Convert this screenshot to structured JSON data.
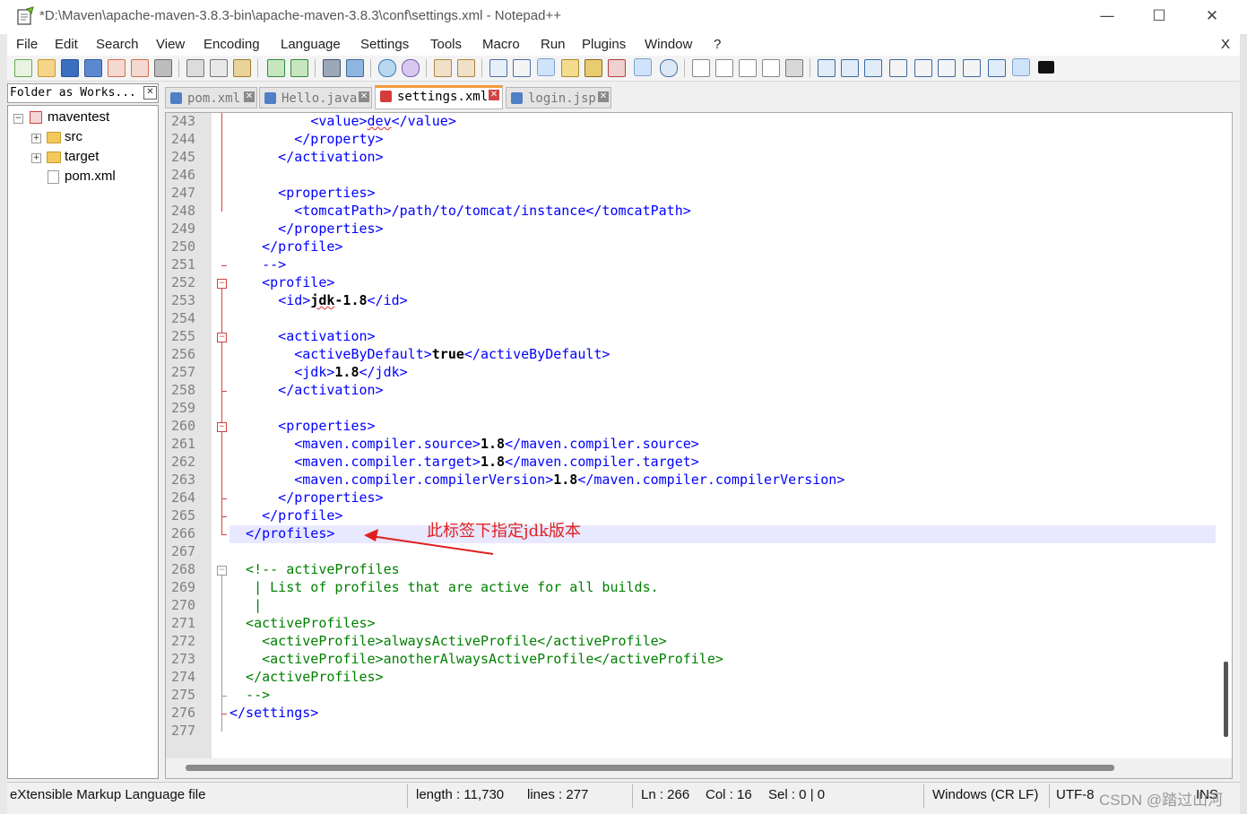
{
  "window": {
    "title": "*D:\\Maven\\apache-maven-3.8.3-bin\\apache-maven-3.8.3\\conf\\settings.xml - Notepad++",
    "minimize": "—",
    "maximize": "☐",
    "close": "✕"
  },
  "menu": {
    "items": [
      "File",
      "Edit",
      "Search",
      "View",
      "Encoding",
      "Language",
      "Settings",
      "Tools",
      "Macro",
      "Run",
      "Plugins",
      "Window",
      "?"
    ],
    "close_doc": "X"
  },
  "toolbar": {
    "icons": [
      "new-file-icon",
      "open-file-icon",
      "save-icon",
      "save-all-icon",
      "close-icon",
      "close-all-icon",
      "print-icon",
      "cut-icon",
      "copy-icon",
      "paste-icon",
      "undo-icon",
      "redo-icon",
      "find-icon",
      "replace-icon",
      "zoom-in-icon",
      "zoom-out-icon",
      "sync-vertical-icon",
      "sync-horizontal-icon",
      "word-wrap-icon",
      "show-all-chars-icon",
      "indent-guide-icon",
      "doc-map-icon",
      "function-list-icon",
      "folder-as-workspace-icon",
      "monitoring-icon",
      "record-macro-icon",
      "stop-record-icon",
      "play-macro-icon",
      "run-macro-multiple-icon",
      "save-macro-icon",
      "compare-icon",
      "plugin-a-icon",
      "plugin-b-icon",
      "first-icon",
      "prev-icon",
      "next-icon",
      "last-icon",
      "diff-icon",
      "spell-check-icon",
      "markdown-icon"
    ]
  },
  "folder_panel": {
    "title": "Folder as Works...",
    "close": "✕",
    "tree": [
      {
        "label": "maventest",
        "kind": "project",
        "expander": "−"
      },
      {
        "label": "src",
        "kind": "folder",
        "expander": "+"
      },
      {
        "label": "target",
        "kind": "folder",
        "expander": "+"
      },
      {
        "label": "pom.xml",
        "kind": "file",
        "expander": ""
      }
    ]
  },
  "tabs": [
    {
      "label": "pom.xml",
      "active": false
    },
    {
      "label": "Hello.java",
      "active": false
    },
    {
      "label": "settings.xml",
      "active": true
    },
    {
      "label": "login.jsp",
      "active": false
    }
  ],
  "tab_close": "✕",
  "editor": {
    "line_numbers": [
      "243",
      "244",
      "245",
      "246",
      "247",
      "248",
      "249",
      "250",
      "251",
      "252",
      "253",
      "254",
      "255",
      "256",
      "257",
      "258",
      "259",
      "260",
      "261",
      "262",
      "263",
      "264",
      "265",
      "266",
      "267",
      "268",
      "269",
      "270",
      "271",
      "272",
      "273",
      "274",
      "275",
      "276",
      "277"
    ],
    "current_line": "266",
    "fold_box": "−",
    "code": {
      "l243": {
        "indent": "          ",
        "open": "<value>",
        "value": "dev",
        "close": "</value>"
      },
      "l244": "        </property>",
      "l245": "      </activation>",
      "l246": "",
      "l247": "      <properties>",
      "l248": "        <tomcatPath>/path/to/tomcat/instance</tomcatPath>",
      "l249": "      </properties>",
      "l250": "    </profile>",
      "l251": "    -->",
      "l252": "    <profile>",
      "l253": {
        "indent": "      ",
        "open": "<id>",
        "value_a": "jdk",
        "value_b": "-1.8",
        "close": "</id>"
      },
      "l254": "",
      "l255": "      <activation>",
      "l256": {
        "indent": "        ",
        "open": "<activeByDefault>",
        "value": "true",
        "close": "</activeByDefault>"
      },
      "l257": {
        "indent": "        ",
        "open": "<jdk>",
        "value": "1.8",
        "close": "</jdk>"
      },
      "l258": "      </activation>",
      "l259": "",
      "l260": "      <properties>",
      "l261": {
        "indent": "        ",
        "open": "<maven.compiler.source>",
        "value": "1.8",
        "close": "</maven.compiler.source>"
      },
      "l262": {
        "indent": "        ",
        "open": "<maven.compiler.target>",
        "value": "1.8",
        "close": "</maven.compiler.target>"
      },
      "l263": {
        "indent": "        ",
        "open": "<maven.compiler.compilerVersion>",
        "value": "1.8",
        "close": "</maven.compiler.compilerVersion>"
      },
      "l264": "      </properties>",
      "l265": "    </profile>",
      "l266": "  </profiles>",
      "l267": "",
      "l268": "  <!-- activeProfiles",
      "l269": "   | List of profiles that are active for all builds.",
      "l270": "   |",
      "l271": "  <activeProfiles>",
      "l272": "    <activeProfile>alwaysActiveProfile</activeProfile>",
      "l273": "    <activeProfile>anotherAlwaysActiveProfile</activeProfile>",
      "l274": "  </activeProfiles>",
      "l275": "  -->",
      "l276": "</settings>",
      "l277": ""
    },
    "annotation": "此标签下指定jdk版本"
  },
  "status": {
    "file_type": "eXtensible Markup Language file",
    "length": "length : 11,730",
    "lines": "lines : 277",
    "ln": "Ln : 266",
    "col": "Col : 16",
    "sel": "Sel : 0 | 0",
    "eol": "Windows (CR LF)",
    "encoding": "UTF-8",
    "mode": "INS"
  },
  "watermark": "CSDN @踏过山河",
  "colors": {
    "tag": "#0000ff",
    "comment": "#008000",
    "fold": "#cc4444",
    "annotation": "#e02020",
    "active_tab": "#f59c3c",
    "current_line_bg": "#e8e8ff"
  }
}
